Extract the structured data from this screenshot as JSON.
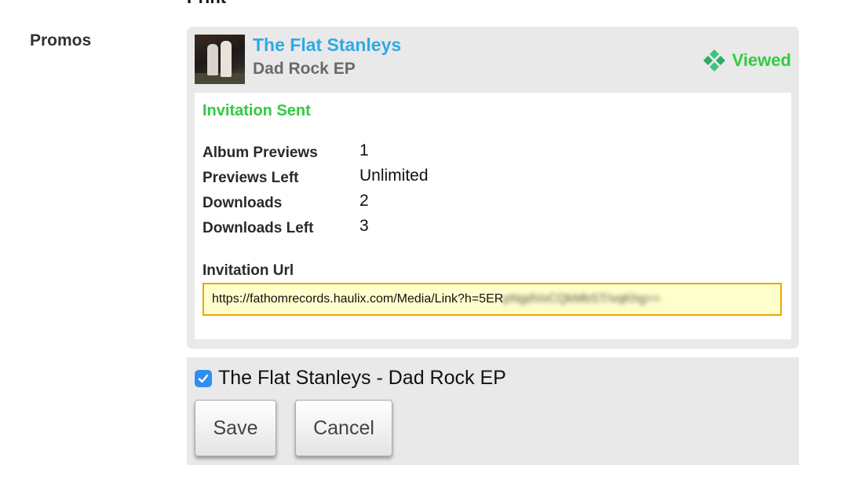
{
  "header": {
    "cut_off_text": "Print",
    "section_label": "Promos"
  },
  "promo": {
    "artist": "The Flat Stanleys",
    "album": "Dad Rock EP",
    "status": "Viewed",
    "status_icon": "viewed-diamond-icon",
    "invitation_status": "Invitation Sent",
    "stats": [
      {
        "label": "Album Previews",
        "value": "1"
      },
      {
        "label": "Previews Left",
        "value": "Unlimited"
      },
      {
        "label": "Downloads",
        "value": "2"
      },
      {
        "label": "Downloads Left",
        "value": "3"
      }
    ],
    "url_label": "Invitation Url",
    "url_visible": "https://fathomrecords.haulix.com/Media/Link?h=5ER",
    "url_obscured": "pNgdVoCQkMbST/vqKhg=="
  },
  "selection": {
    "item_label": "The Flat Stanleys - Dad Rock EP",
    "checked": true
  },
  "buttons": {
    "save": "Save",
    "cancel": "Cancel"
  },
  "colors": {
    "artist_link": "#2fa9e6",
    "status_green": "#2ecc40",
    "url_border": "#f0a500",
    "url_bg": "#ffffcc",
    "checkbox": "#2f8ef0"
  }
}
